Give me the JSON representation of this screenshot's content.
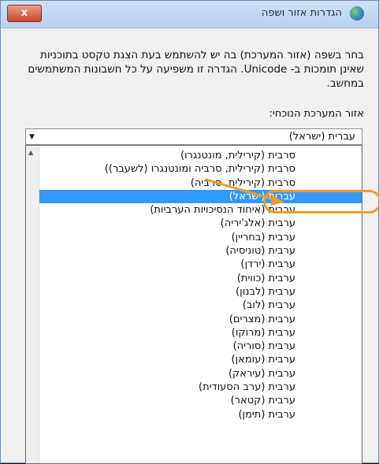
{
  "window": {
    "title": "הגדרות אזור ושפה",
    "close_label": "x"
  },
  "description": "בחר בשפה (אזור המערכת) בה יש להשתמש בעת הצגת טקסט בתוכניות שאינן תומכות ב- Unicode. הגדרה זו משפיעה על כל חשבונות המשתמשים במחשב.",
  "current_locale_label": "אזור המערכת הנוכחי:",
  "combo": {
    "value": "עברית (ישראל)"
  },
  "dropdown": {
    "items": [
      "סרבית (קירילית, מונטנגרו)",
      "סרבית (קירילית, סרביה ומונטנגרו (לשעבר))",
      "סרבית (קירילית, סרביה)",
      "עברית (ישראל)",
      "ערבית (איחוד הנסיכויות הערביות)",
      "ערבית (אלג'יריה)",
      "ערבית (בחריין)",
      "ערבית (טוניסיה)",
      "ערבית (ירדן)",
      "ערבית (כווית)",
      "ערבית (לבנון)",
      "ערבית (לוב)",
      "ערבית (מצרים)",
      "ערבית (מרוקו)",
      "ערבית (סוריה)",
      "ערבית (עומאן)",
      "ערבית (עיראק)",
      "ערבית (ערב הסעודית)",
      "ערבית (קטאר)",
      "ערבית (תימן)"
    ],
    "selected": "עברית (ישראל)"
  },
  "colors": {
    "selection": "#3399ff",
    "annotation": "#f29a2e"
  },
  "icons": {
    "title_icon": "globe-icon",
    "close": "close-icon",
    "combo_arrow": "dropdown-arrow-icon",
    "scroll_up": "scroll-up-icon"
  }
}
